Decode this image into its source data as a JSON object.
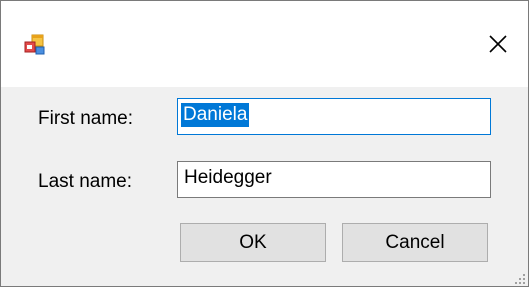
{
  "window": {
    "title": "",
    "close_label": "×"
  },
  "form": {
    "first_name_label": "First name:",
    "first_name_value": "Daniela",
    "last_name_label": "Last name:",
    "last_name_value": "Heidegger"
  },
  "buttons": {
    "ok_label": "OK",
    "cancel_label": "Cancel"
  },
  "icons": {
    "app": "app-window-icon",
    "close": "close-icon",
    "grip": "resize-grip-icon"
  },
  "colors": {
    "accent": "#0078d7",
    "dialog_background": "#f0f0f0",
    "button_background": "#e1e1e1"
  }
}
